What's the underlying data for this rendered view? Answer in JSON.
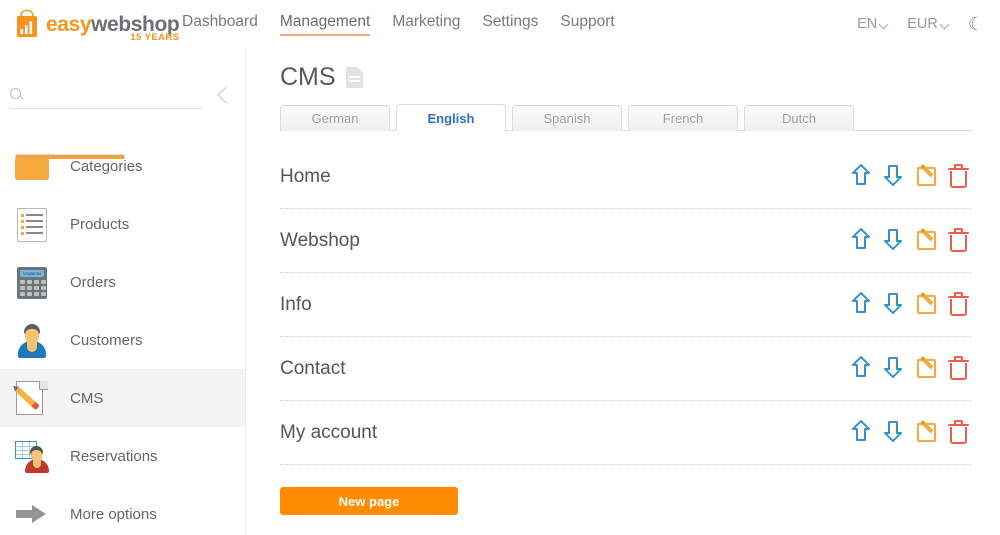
{
  "header": {
    "logo": {
      "part1": "easy",
      "part2": "webshop",
      "tagline": "15 YEARS",
      "icon": "shopping-bag-chart-icon"
    },
    "nav": [
      {
        "label": "Dashboard",
        "active": false
      },
      {
        "label": "Management",
        "active": true
      },
      {
        "label": "Marketing",
        "active": false
      },
      {
        "label": "Settings",
        "active": false
      },
      {
        "label": "Support",
        "active": false
      }
    ],
    "language": "EN",
    "currency": "EUR",
    "dark_mode_icon": "moon-icon",
    "accent_underline": "#F0A882"
  },
  "sidebar": {
    "search": {
      "placeholder": "",
      "value": "",
      "icon": "search-icon"
    },
    "collapse_icon": "chevron-left-icon",
    "items": [
      {
        "label": "Categories",
        "icon": "folder-icon",
        "active": false
      },
      {
        "label": "Products",
        "icon": "document-list-icon",
        "active": false
      },
      {
        "label": "Orders",
        "icon": "calculator-icon",
        "active": false
      },
      {
        "label": "Customers",
        "icon": "customer-icon",
        "active": false
      },
      {
        "label": "CMS",
        "icon": "page-edit-icon",
        "active": true
      },
      {
        "label": "Reservations",
        "icon": "reservations-icon",
        "active": false
      },
      {
        "label": "More options",
        "icon": "arrow-right-icon",
        "active": false
      }
    ],
    "calculator_display": "123456789"
  },
  "main": {
    "title": "CMS",
    "title_icon": "document-icon",
    "tabs": [
      {
        "label": "German",
        "active": false
      },
      {
        "label": "English",
        "active": true
      },
      {
        "label": "Spanish",
        "active": false
      },
      {
        "label": "French",
        "active": false
      },
      {
        "label": "Dutch",
        "active": false
      }
    ],
    "pages": [
      {
        "name": "Home"
      },
      {
        "name": "Webshop"
      },
      {
        "name": "Info"
      },
      {
        "name": "Contact"
      },
      {
        "name": "My account"
      }
    ],
    "row_actions": {
      "move_up": "arrow-up-icon",
      "move_down": "arrow-down-icon",
      "edit": "edit-pencil-icon",
      "delete": "trash-icon"
    },
    "new_page_button": "New page"
  },
  "colors": {
    "brand_orange": "#F7941E",
    "button_orange": "#FF8C00",
    "tab_active_blue": "#2E6FD4",
    "action_blue": "#3D8FC7",
    "action_orange": "#F5A93F",
    "action_red": "#EF5B4C"
  }
}
